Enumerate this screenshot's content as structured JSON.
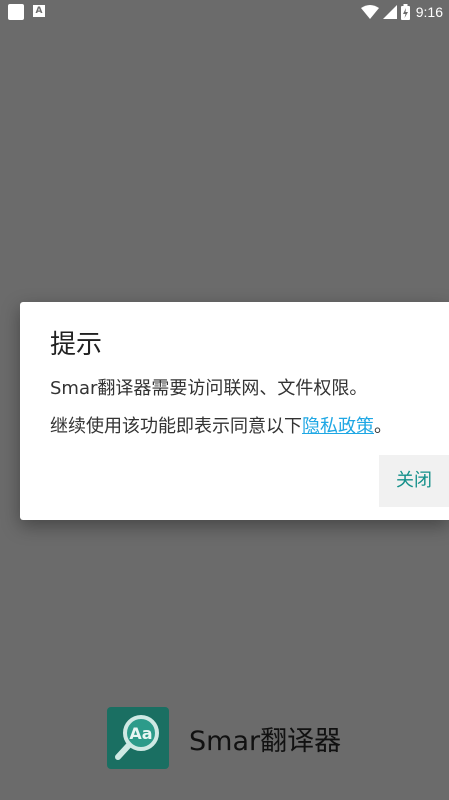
{
  "status_bar": {
    "time": "9:16",
    "left_icons": [
      "notification-square-icon",
      "font-a-icon"
    ],
    "right_icons": [
      "wifi-icon",
      "cell-signal-icon",
      "battery-charging-icon"
    ],
    "notification_letter": "A"
  },
  "dialog": {
    "title": "提示",
    "message_line1": "Smar翻译器需要访问联网、文件权限。",
    "message_line2_prefix": "继续使用该功能即表示同意以下",
    "privacy_link": "隐私政策",
    "message_line2_suffix": "。",
    "close_label": "关闭"
  },
  "app": {
    "name": "Smar翻译器",
    "icon_text": "Aa"
  },
  "colors": {
    "scrim": "#6b6b6b",
    "accent": "#14908a",
    "link": "#1ea7e4",
    "app_icon_bg": "#1a6f62"
  }
}
